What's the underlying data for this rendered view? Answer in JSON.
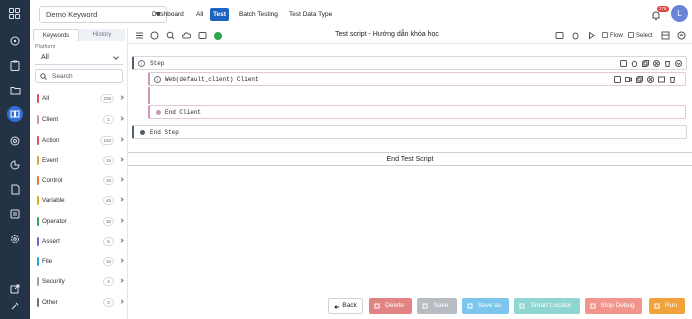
{
  "topbar": {
    "project": "Demo Keyword",
    "tabs": [
      {
        "label": "Dashboard",
        "active": false
      },
      {
        "label": "All",
        "active": false
      },
      {
        "label": "Test",
        "active": true
      },
      {
        "label": "Batch Testing",
        "active": false
      },
      {
        "label": "Test Data Type",
        "active": false
      }
    ],
    "notification_count": "278",
    "avatar_initial": "L"
  },
  "rail": {
    "icons": [
      "grid-logo-icon",
      "compass-icon",
      "clipboard-icon",
      "folder-icon",
      "book-icon",
      "gauge-icon",
      "chart-icon",
      "document-icon",
      "settings-icon",
      "external-link-icon",
      "tools-icon"
    ],
    "active": "book-icon"
  },
  "panel": {
    "tabs": [
      "Keywords",
      "History"
    ],
    "active_tab": "Keywords",
    "platform_label": "Platform",
    "platform_value": "All",
    "search_placeholder": "Search",
    "categories": [
      {
        "name": "All",
        "count": "239",
        "color": "#e05151"
      },
      {
        "name": "Client",
        "count": "1",
        "color": "#c998b8"
      },
      {
        "name": "Action",
        "count": "102",
        "color": "#e05151"
      },
      {
        "name": "Event",
        "count": "15",
        "color": "#e7a13b"
      },
      {
        "name": "Control",
        "count": "15",
        "color": "#e07a3b"
      },
      {
        "name": "Variable",
        "count": "45",
        "color": "#d8b21c"
      },
      {
        "name": "Operator",
        "count": "30",
        "color": "#3aa55a"
      },
      {
        "name": "Assert",
        "count": "5",
        "color": "#7b5fd1"
      },
      {
        "name": "File",
        "count": "16",
        "color": "#2e9fd8"
      },
      {
        "name": "Security",
        "count": "4",
        "color": "#9aa3ad"
      },
      {
        "name": "Other",
        "count": "3",
        "color": "#6b7380"
      }
    ]
  },
  "editor": {
    "title": "Test script - Hướng dẫn khóa học",
    "flow_label": "Flow",
    "select_label": "Select",
    "step": "Step",
    "client": "Web(default_client) Client",
    "end_client": "End Client",
    "end_step": "End Step",
    "end_script": "End Test Script",
    "colors": {
      "client": "#c998b8",
      "status": "#2ea44f"
    }
  },
  "buttons": [
    {
      "label": "Back",
      "color": "#ffffff"
    },
    {
      "label": "Delete",
      "color": "#e38484"
    },
    {
      "label": "Save",
      "color": "#b7bcc2"
    },
    {
      "label": "Save as",
      "color": "#7cc5ec"
    },
    {
      "label": "Smart Locator",
      "color": "#8fd6d3"
    },
    {
      "label": "Stop Debug",
      "color": "#f2958c"
    },
    {
      "label": "Run",
      "color": "#f2a23b"
    }
  ]
}
